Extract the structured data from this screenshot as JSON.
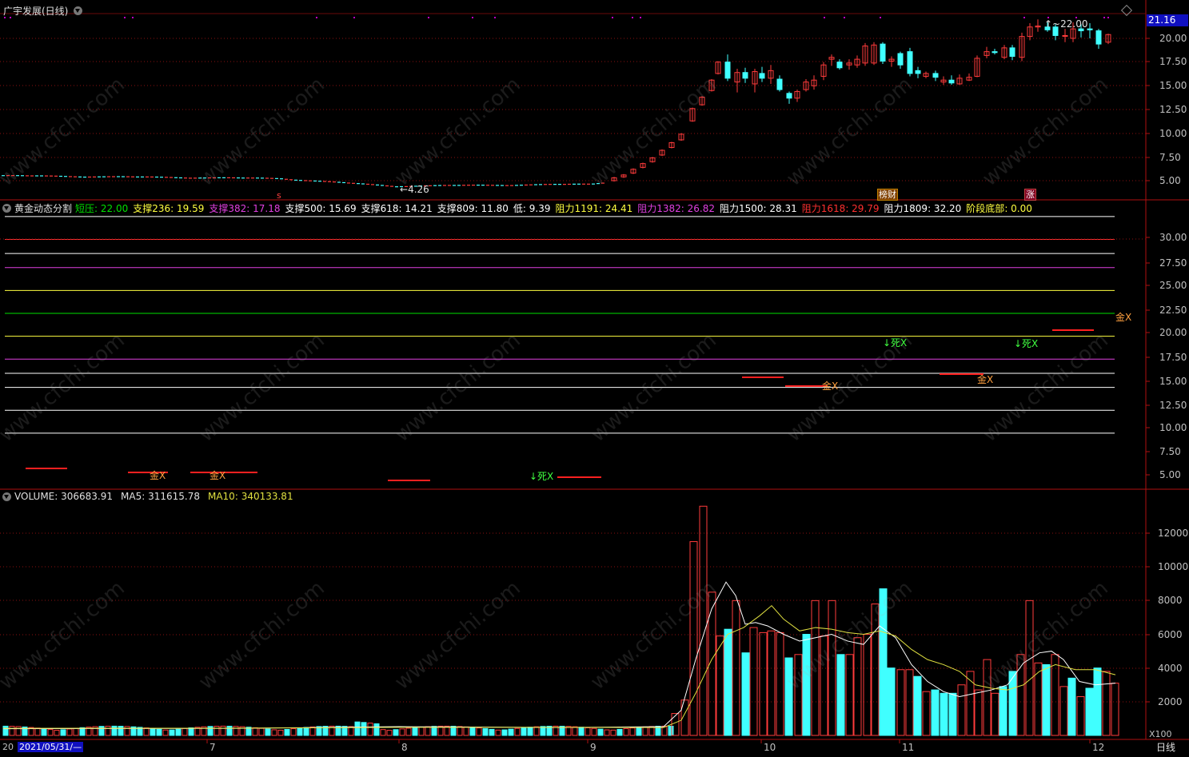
{
  "window": {
    "title": "广宇发展(日线)",
    "period_tab": "日线"
  },
  "current_price": "21.16",
  "price_axis": [
    "20.00",
    "17.50",
    "15.00",
    "12.50",
    "10.00",
    "7.50",
    "5.00"
  ],
  "price_annotations": {
    "high": "22.00",
    "low": "4.26",
    "low_prefix": "←"
  },
  "badges": {
    "s": "s",
    "lhb": "榜财",
    "zhang": "涨"
  },
  "gold_panel": {
    "name": "黄金动态分割",
    "items": [
      {
        "label": "短压",
        "value": "22.00",
        "color": "#00e000"
      },
      {
        "label": "支撑236",
        "value": "19.59",
        "color": "#ffff40"
      },
      {
        "label": "支撑382",
        "value": "17.18",
        "color": "#e040e0"
      },
      {
        "label": "支撑500",
        "value": "15.69",
        "color": "#ffffff"
      },
      {
        "label": "支撑618",
        "value": "14.21",
        "color": "#ffffff"
      },
      {
        "label": "支撑809",
        "value": "11.80",
        "color": "#ffffff"
      },
      {
        "label": "低",
        "value": "9.39",
        "color": "#ffffff"
      },
      {
        "label": "阻力1191",
        "value": "24.41",
        "color": "#ffff40"
      },
      {
        "label": "阻力1382",
        "value": "26.82",
        "color": "#e040e0"
      },
      {
        "label": "阻力1500",
        "value": "28.31",
        "color": "#ffffff"
      },
      {
        "label": "阻力1618",
        "value": "29.79",
        "color": "#ff3030"
      },
      {
        "label": "阻力1809",
        "value": "32.20",
        "color": "#ffffff"
      },
      {
        "label": "阶段底部",
        "value": "0.00",
        "color": "#ffff40"
      }
    ],
    "axis": [
      "30.00",
      "27.50",
      "25.00",
      "22.50",
      "20.00",
      "17.50",
      "15.00",
      "12.50",
      "10.00",
      "7.50",
      "5.00"
    ],
    "signals": [
      {
        "text": "金X",
        "color": "#ffa040"
      },
      {
        "text": "金X",
        "color": "#ffa040"
      },
      {
        "text": "↓死X",
        "color": "#40ff40"
      },
      {
        "text": "金X",
        "color": "#ffa040"
      },
      {
        "text": "↓死X",
        "color": "#40ff40"
      },
      {
        "text": "金X",
        "color": "#ffa040"
      },
      {
        "text": "↓死X",
        "color": "#40ff40"
      },
      {
        "text": "金X",
        "color": "#ffa040"
      }
    ]
  },
  "volume_panel": {
    "name": "VOLUME",
    "value": "306683.91",
    "ma5_label": "MA5",
    "ma5": "311615.78",
    "ma10_label": "MA10",
    "ma10": "340133.81",
    "axis": [
      "12000",
      "10000",
      "8000",
      "6000",
      "4000",
      "2000"
    ],
    "unit": "X100"
  },
  "date_axis": {
    "selected": "2021/05/31/—",
    "left_prefix": "20",
    "months": [
      "7",
      "8",
      "9",
      "10",
      "11",
      "12"
    ]
  },
  "watermark": "www.cfchi.com",
  "colors": {
    "up": "#ff3b3b",
    "down": "#40ffff",
    "grid": "#8a1010",
    "ma5": "#ffffff",
    "ma10": "#e0e040"
  }
}
